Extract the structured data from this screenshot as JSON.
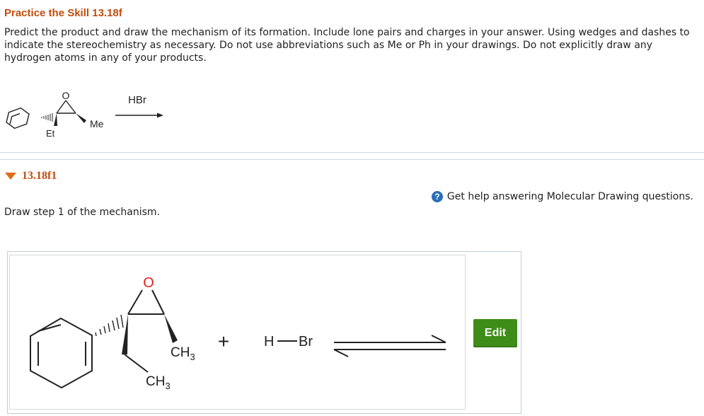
{
  "problem": {
    "title": "Practice the Skill 13.18f",
    "prompt": "Predict the product and draw the mechanism of its formation. Include lone pairs and charges in your answer. Using wedges and dashes to indicate the stereochemistry as necessary. Do not use abbreviations such as Me or Ph in your drawings. Do not explicitly draw any hydrogen atoms in any of your products.",
    "reaction": {
      "reagent": "HBr",
      "sub_me": "Me",
      "sub_et": "Et",
      "oxygen": "O"
    }
  },
  "part": {
    "label": "13.18f1",
    "help_text": "Get help answering Molecular Drawing questions.",
    "help_icon": "?",
    "instruction": "Draw step 1 of the mechanism.",
    "edit_label": "Edit"
  },
  "drawing": {
    "oxygen": "O",
    "ch3_a": "CH",
    "ch3_a_sub": "3",
    "ch3_b": "CH",
    "ch3_b_sub": "3",
    "plus": "+",
    "hbr_h": "H",
    "hbr_br": "Br"
  },
  "colors": {
    "title": "#c24c0c",
    "oxygen": "#e02020",
    "edit_button": "#3f8d19",
    "help_icon": "#2a6fb8"
  }
}
